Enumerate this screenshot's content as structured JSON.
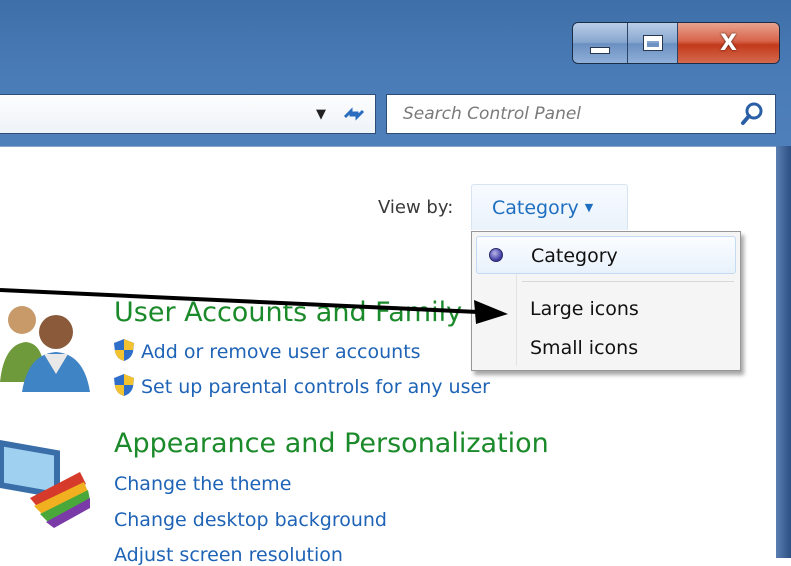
{
  "window": {
    "caption_buttons": {
      "minimize": "minimize-icon",
      "maximize": "maximize-icon",
      "close_label": "X"
    }
  },
  "toolbar": {
    "search_placeholder": "Search Control Panel"
  },
  "view": {
    "label": "View by:",
    "selected": "Category",
    "menu": [
      {
        "label": "Category",
        "checked": true
      },
      {
        "label": "Large icons",
        "checked": false
      },
      {
        "label": "Small icons",
        "checked": false
      }
    ]
  },
  "categories": [
    {
      "title": "User Accounts and Family",
      "tasks": [
        "Add or remove user accounts",
        "Set up parental controls for any user"
      ]
    },
    {
      "title": "Appearance and Personalization",
      "tasks": [
        "Change the theme",
        "Change desktop background",
        "Adjust screen resolution"
      ]
    }
  ],
  "colors": {
    "category_title": "#1b8a2a",
    "link": "#1e63b6",
    "frame": "#4a7cb8"
  }
}
